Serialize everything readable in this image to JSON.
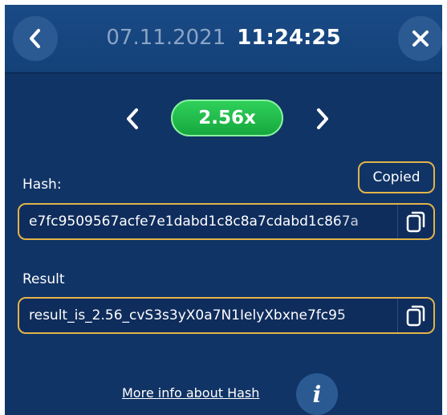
{
  "header": {
    "date": "07.11.2021",
    "time": "11:24:25",
    "back_icon": "chevron-left-icon",
    "close_icon": "close-icon"
  },
  "multiplier": {
    "value": "2.56x",
    "prev_icon": "chevron-left-icon",
    "next_icon": "chevron-right-icon"
  },
  "hash": {
    "label": "Hash:",
    "value": "e7fc9509567acfe7e1dabd1c8c8a7cdabd1c867a",
    "copied_label": "Copied",
    "copy_icon": "copy-icon"
  },
  "result": {
    "label": "Result",
    "value": "result_is_2.56_cvS3s3yX0a7N1IelyXbxne7fc95",
    "copy_icon": "copy-icon"
  },
  "footer": {
    "more_info_label": "More info about Hash",
    "info_icon": "info-icon",
    "info_glyph": "i"
  },
  "colors": {
    "background": "#113466",
    "accent_border": "#e2b34a",
    "pill_green": "#1fbb4a",
    "date_muted": "#8aa4c6"
  }
}
